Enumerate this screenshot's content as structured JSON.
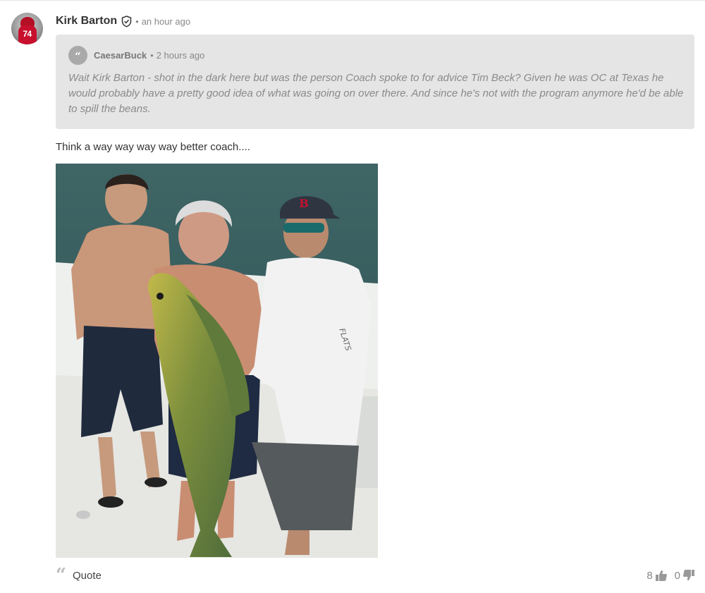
{
  "post": {
    "avatar_number": "74",
    "author": "Kirk Barton",
    "time": "an hour ago",
    "body": "Think a way way way way better coach...."
  },
  "quote": {
    "author": "CaesarBuck",
    "time": "2 hours ago",
    "text": "Wait Kirk Barton - shot in the dark here but was the person Coach spoke to for advice Tim Beck? Given he was OC at Texas he would probably have a pretty good idea of what was going on over there. And since he's not with the program anymore he'd be able to spill the beans."
  },
  "photo": {
    "cap_letter": "B",
    "sleeve_text": "FLATS"
  },
  "footer": {
    "quote_label": "Quote",
    "upvotes": "8",
    "downvotes": "0"
  },
  "icons": {
    "verified": "shield-check-icon",
    "quote": "quote-icon",
    "up": "thumbs-up-icon",
    "down": "thumbs-down-icon"
  },
  "colors": {
    "quote_bg": "#e5e5e5",
    "avatar_red": "#c8102e",
    "muted_text": "#888888"
  }
}
